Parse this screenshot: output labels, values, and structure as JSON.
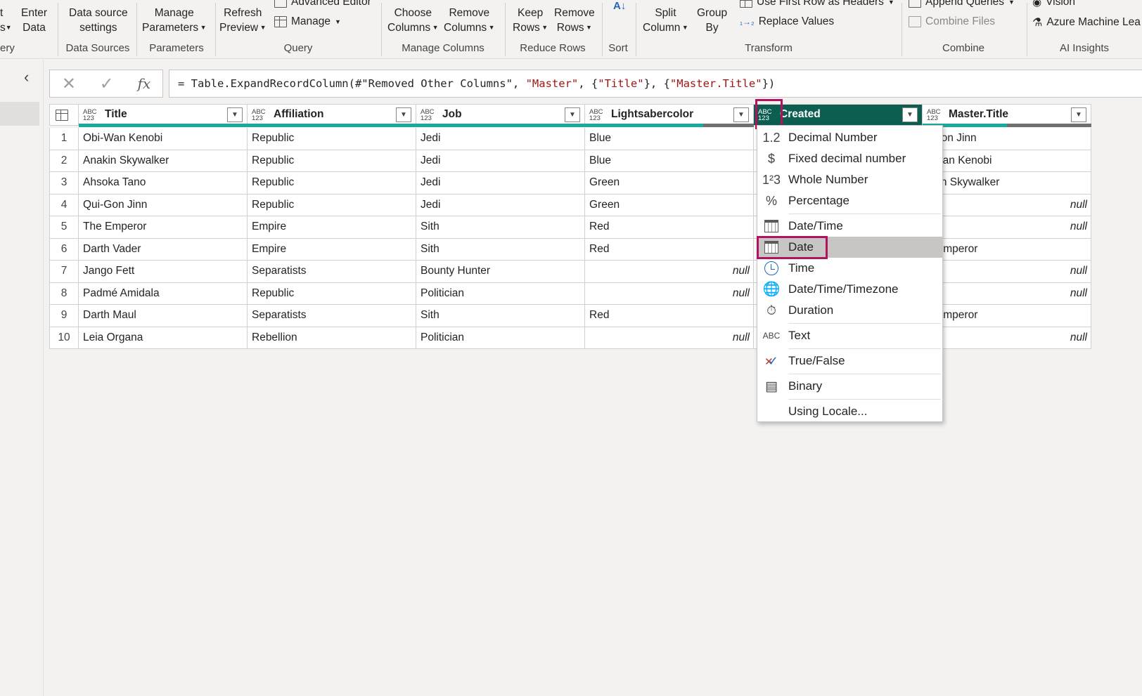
{
  "ribbon": {
    "frag_left_top": "t",
    "frag_left_bottom": "s",
    "frag_group_left": "ery",
    "enter_data": [
      "Enter",
      "Data"
    ],
    "data_source_settings": [
      "Data source",
      "settings"
    ],
    "group_data_sources": "Data Sources",
    "manage_parameters": [
      "Manage",
      "Parameters"
    ],
    "group_parameters": "Parameters",
    "refresh_preview": [
      "Refresh",
      "Preview"
    ],
    "advanced_editor": "Advanced Editor",
    "manage": "Manage",
    "group_query": "Query",
    "choose_columns": [
      "Choose",
      "Columns"
    ],
    "remove_columns": [
      "Remove",
      "Columns"
    ],
    "group_manage_columns": "Manage Columns",
    "keep_rows": [
      "Keep",
      "Rows"
    ],
    "remove_rows": [
      "Remove",
      "Rows"
    ],
    "group_reduce_rows": "Reduce Rows",
    "group_sort": "Sort",
    "split_column": [
      "Split",
      "Column"
    ],
    "group_by": [
      "Group",
      "By"
    ],
    "use_first_row": "Use First Row as Headers",
    "replace_values": "Replace Values",
    "group_transform": "Transform",
    "append_queries": "Append Queries",
    "combine_files": "Combine Files",
    "group_combine": "Combine",
    "vision": "Vision",
    "azure_ml": "Azure Machine Lea",
    "group_ai_insights": "AI Insights"
  },
  "formula": {
    "prefix": "= Table.ExpandRecordColumn(#\"Removed Other Columns\", ",
    "s1": "\"Master\"",
    "mid1": ", {",
    "s2": "\"Title\"",
    "mid2": "}, {",
    "s3": "\"Master.Title\"",
    "suffix": "})"
  },
  "table": {
    "type_label_top": "ABC",
    "type_label_bottom": "123",
    "columns": [
      "Title",
      "Affiliation",
      "Job",
      "Lightsabercolor",
      "Created",
      "Master.Title"
    ],
    "rows": [
      {
        "idx": "1",
        "title": "Obi-Wan Kenobi",
        "affiliation": "Republic",
        "job": "Jedi",
        "color": "Blue",
        "master": "i-Gon Jinn"
      },
      {
        "idx": "2",
        "title": "Anakin Skywalker",
        "affiliation": "Republic",
        "job": "Jedi",
        "color": "Blue",
        "master": "i-Wan Kenobi"
      },
      {
        "idx": "3",
        "title": "Ahsoka Tano",
        "affiliation": "Republic",
        "job": "Jedi",
        "color": "Green",
        "master": "akin Skywalker"
      },
      {
        "idx": "4",
        "title": "Qui-Gon Jinn",
        "affiliation": "Republic",
        "job": "Jedi",
        "color": "Green",
        "master": null
      },
      {
        "idx": "5",
        "title": "The Emperor",
        "affiliation": "Empire",
        "job": "Sith",
        "color": "Red",
        "master": null
      },
      {
        "idx": "6",
        "title": "Darth Vader",
        "affiliation": "Empire",
        "job": "Sith",
        "color": "Red",
        "master": "e Emperor"
      },
      {
        "idx": "7",
        "title": "Jango Fett",
        "affiliation": "Separatists",
        "job": "Bounty Hunter",
        "color": null,
        "master": null
      },
      {
        "idx": "8",
        "title": "Padmé Amidala",
        "affiliation": "Republic",
        "job": "Politician",
        "color": null,
        "master": null
      },
      {
        "idx": "9",
        "title": "Darth Maul",
        "affiliation": "Separatists",
        "job": "Sith",
        "color": "Red",
        "master": "e Emperor"
      },
      {
        "idx": "10",
        "title": "Leia Organa",
        "affiliation": "Rebellion",
        "job": "Politician",
        "color": null,
        "master": null
      }
    ],
    "null_text": "null"
  },
  "type_menu": {
    "items": [
      {
        "label": "Decimal Number",
        "icon": "1.2"
      },
      {
        "label": "Fixed decimal number",
        "icon": "$"
      },
      {
        "label": "Whole Number",
        "icon": "1²3"
      },
      {
        "label": "Percentage",
        "icon": "%"
      },
      {
        "label": "Date/Time"
      },
      {
        "label": "Date"
      },
      {
        "label": "Time"
      },
      {
        "label": "Date/Time/Timezone"
      },
      {
        "label": "Duration"
      },
      {
        "label": "Text",
        "icon": "ABC"
      },
      {
        "label": "True/False"
      },
      {
        "label": "Binary"
      },
      {
        "label": "Using Locale..."
      }
    ],
    "selected": "Date"
  },
  "colors": {
    "accent": "#0b5e50",
    "highlight": "#b0145e",
    "quality_bar": "#1aaa9a"
  }
}
